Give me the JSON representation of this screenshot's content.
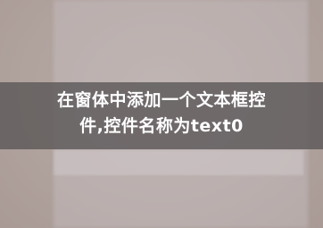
{
  "caption": {
    "line1": "在窗体中添加一个文本框控",
    "line2": "件,控件名称为text0"
  },
  "colors": {
    "background": "#b0a29d",
    "band": "#585456",
    "text": "#ffffff"
  }
}
